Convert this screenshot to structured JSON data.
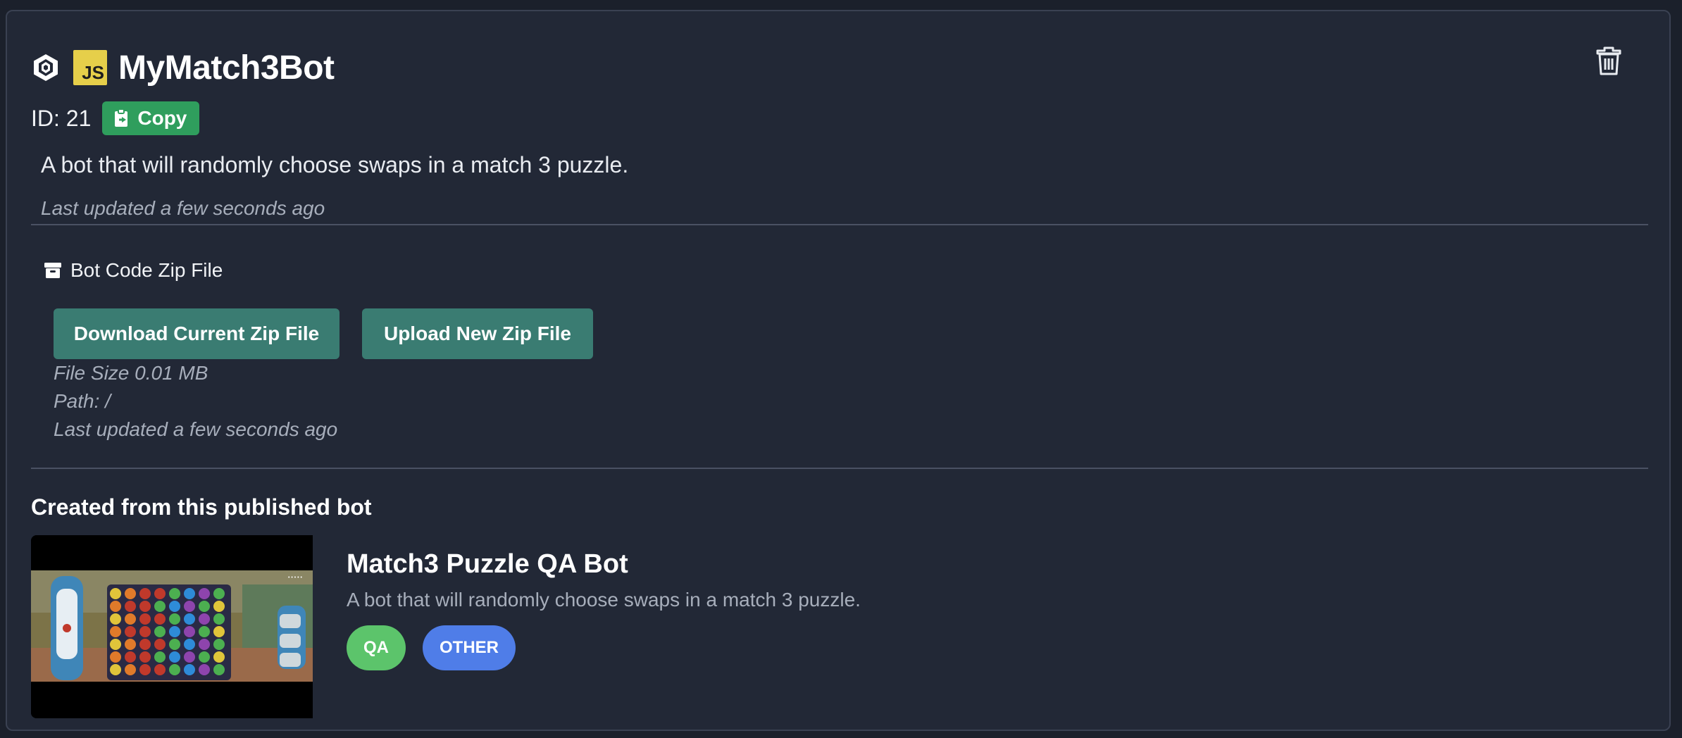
{
  "bot": {
    "title": "MyMatch3Bot",
    "id_label": "ID: 21",
    "copy_label": "Copy",
    "description": "A bot that will randomly choose swaps in a match 3 puzzle.",
    "updated": "Last updated a few seconds ago"
  },
  "zip": {
    "heading": "Bot Code Zip File",
    "download_label": "Download Current Zip File",
    "upload_label": "Upload New Zip File",
    "file_size": "File Size 0.01 MB",
    "path": "Path: /",
    "updated": "Last updated a few seconds ago"
  },
  "published": {
    "section_title": "Created from this published bot",
    "name": "Match3 Puzzle QA Bot",
    "description": "A bot that will randomly choose swaps in a match 3 puzzle.",
    "tags": [
      {
        "label": "QA",
        "color": "#5cc46b"
      },
      {
        "label": "OTHER",
        "color": "#4f7de8"
      }
    ]
  },
  "icons": [
    "unity-icon",
    "javascript-icon",
    "trash-icon",
    "clipboard-icon",
    "archive-icon"
  ],
  "colors": {
    "background": "#1b202b",
    "card": "#222836",
    "copy_button": "#2f9e5d",
    "action_button": "#3a7c72",
    "js_badge": "#e6cf4a"
  }
}
